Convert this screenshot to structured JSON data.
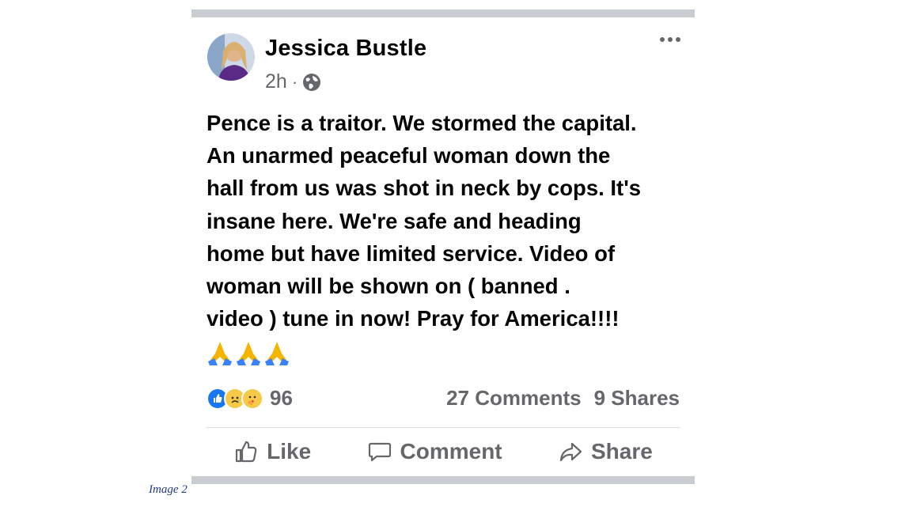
{
  "post": {
    "author": "Jessica Bustle",
    "time": "2h",
    "separator": "·",
    "privacy_icon": "globe-icon",
    "more_icon": "more-options-icon",
    "text": "Pence is a traitor. We stormed the capital.\nAn unarmed peaceful woman down the\nhall from us was shot in neck by cops. It's\ninsane here. We're safe and heading\nhome but have limited service. Video of\nwoman will be shown on ( banned .\nvideo ) tune in now! Pray for America!!!!",
    "emojis": [
      "folded-hands-icon",
      "folded-hands-icon",
      "folded-hands-icon"
    ]
  },
  "reactions": {
    "icons": [
      "like-reaction-icon",
      "sad-reaction-icon",
      "care-reaction-icon"
    ],
    "count": "96"
  },
  "stats": {
    "comments": "27 Comments",
    "shares": "9 Shares"
  },
  "actions": {
    "like": "Like",
    "comment": "Comment",
    "share": "Share"
  },
  "caption": "Image 2",
  "colors": {
    "frame": "#c9ccd1",
    "secondary_text": "#65676b",
    "like_blue": "#1877f2",
    "caption": "#1f3a8a"
  }
}
